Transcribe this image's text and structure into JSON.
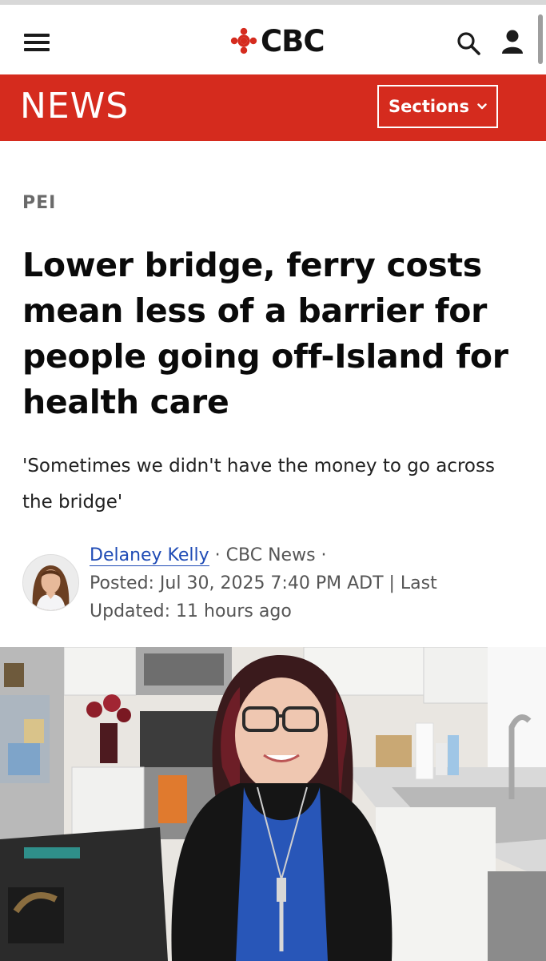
{
  "header": {
    "brand": "CBC",
    "news_label": "NEWS",
    "sections_label": "Sections"
  },
  "article": {
    "category": "PEI",
    "headline": "Lower bridge, ferry costs mean less of a barrier for people going off-Island for health care",
    "deck": "'Sometimes we didn't have the money to go across the bridge'",
    "author": "Delaney Kelly",
    "outlet": "CBC News",
    "posted": "Posted: Jul 30, 2025 7:40 PM ADT | Last Updated: 11 hours ago"
  },
  "colors": {
    "brand_red": "#d52b1e",
    "link_blue": "#1f4bb5"
  },
  "icons": [
    "hamburger-menu-icon",
    "cbc-gem-logo",
    "search-icon",
    "user-icon",
    "chevron-down-icon"
  ]
}
